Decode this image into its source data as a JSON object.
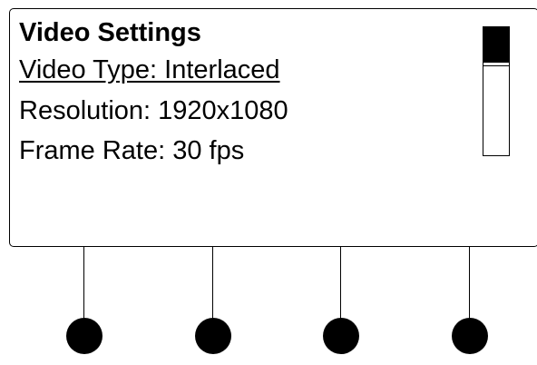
{
  "menu": {
    "title": "Video Settings",
    "items": [
      {
        "label": "Video Type: Interlaced",
        "selected": true
      },
      {
        "label": "Resolution: 1920x1080",
        "selected": false
      },
      {
        "label": "Frame Rate: 30 fps",
        "selected": false
      }
    ]
  },
  "scroll": {
    "visible_fraction": 0.28,
    "position": 0
  },
  "softkeys": [
    {
      "icon": "softkey-1-button"
    },
    {
      "icon": "softkey-2-button"
    },
    {
      "icon": "softkey-3-button"
    },
    {
      "icon": "softkey-4-button"
    }
  ]
}
